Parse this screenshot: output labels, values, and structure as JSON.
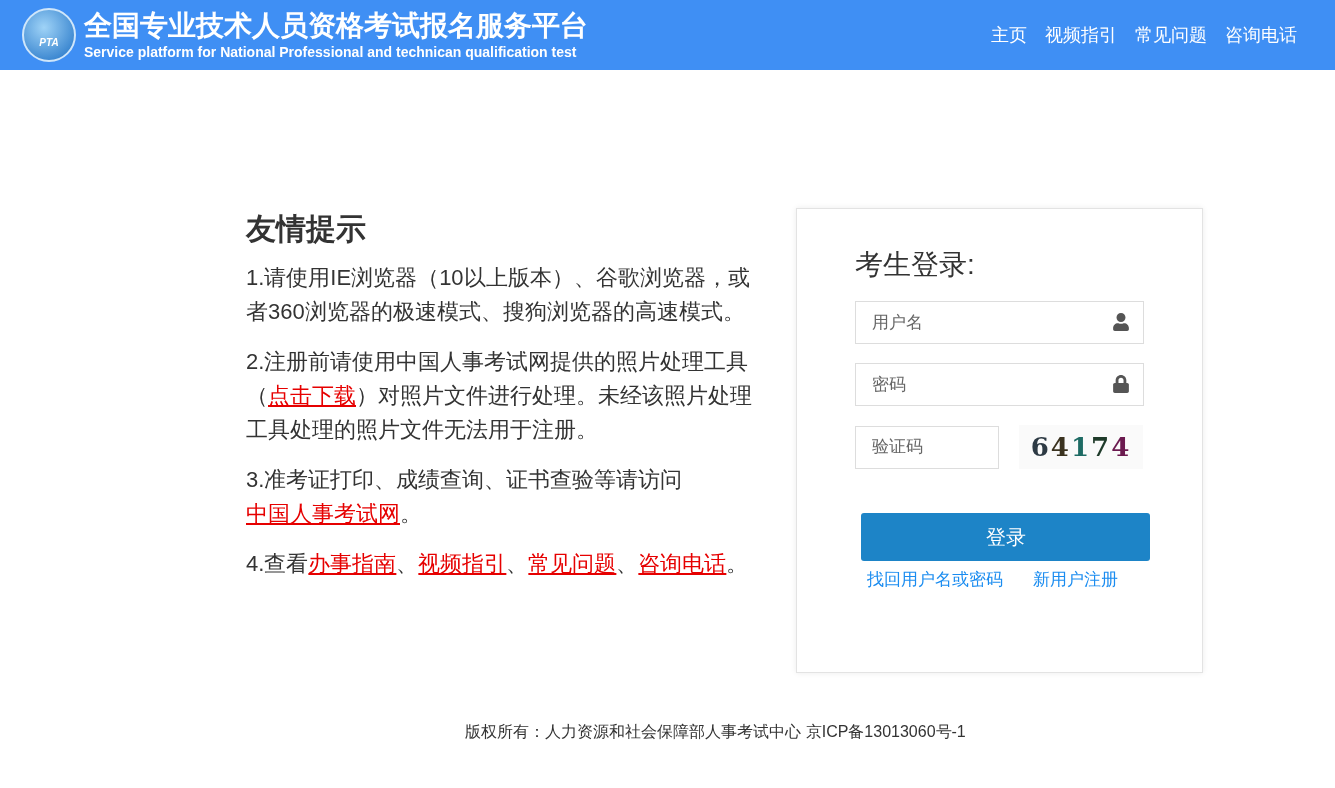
{
  "header": {
    "title": "全国专业技术人员资格考试报名服务平台",
    "subtitle": "Service platform for National Professional and technican qualification test",
    "logo_text": "PTA",
    "nav": [
      {
        "label": "主页"
      },
      {
        "label": "视频指引"
      },
      {
        "label": "常见问题"
      },
      {
        "label": "咨询电话"
      }
    ]
  },
  "tips": {
    "title": "友情提示",
    "paragraphs": [
      [
        {
          "kind": "text",
          "text": "1.请使用IE浏览器（10以上版本）、谷歌浏览器，或者360浏览器的极速模式、搜狗浏览器的高速模式。"
        }
      ],
      [
        {
          "kind": "text",
          "text": "2.注册前请使用中国人事考试网提供的照片处理工具（"
        },
        {
          "kind": "link",
          "text": "点击下载"
        },
        {
          "kind": "text",
          "text": "）对照片文件进行处理。未经该照片处理工具处理的照片文件无法用于注册。"
        }
      ],
      [
        {
          "kind": "text",
          "text": "3.准考证打印、成绩查询、证书查验等请访问"
        },
        {
          "kind": "link",
          "text": "中国人事考试网"
        },
        {
          "kind": "text",
          "text": "。"
        }
      ],
      [
        {
          "kind": "text",
          "text": "4.查看"
        },
        {
          "kind": "link",
          "text": "办事指南"
        },
        {
          "kind": "text",
          "text": "、"
        },
        {
          "kind": "link",
          "text": "视频指引"
        },
        {
          "kind": "text",
          "text": "、"
        },
        {
          "kind": "link",
          "text": "常见问题"
        },
        {
          "kind": "text",
          "text": "、"
        },
        {
          "kind": "link",
          "text": "咨询电话"
        },
        {
          "kind": "text",
          "text": "。"
        }
      ]
    ]
  },
  "login": {
    "title": "考生登录:",
    "username": {
      "placeholder": "用户名"
    },
    "password": {
      "placeholder": "密码"
    },
    "captcha": {
      "placeholder": "验证码",
      "image_text": "64174"
    },
    "submit": "登录",
    "links": [
      {
        "label": "找回用户名或密码"
      },
      {
        "label": "新用户注册"
      }
    ]
  },
  "footer": "版权所有：人力资源和社会保障部人事考试中心 京ICP备13013060号-1"
}
